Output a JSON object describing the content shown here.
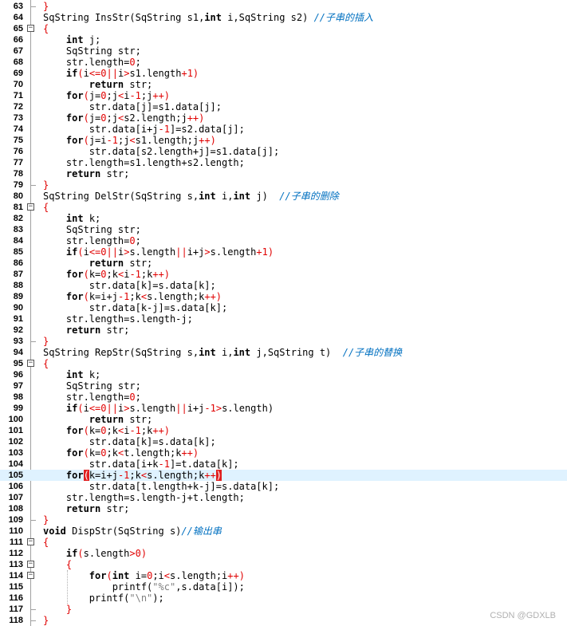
{
  "editor": {
    "lines": [
      {
        "n": "63",
        "fold": "end",
        "segs": [
          {
            "t": "}",
            "c": "tok-br"
          }
        ]
      },
      {
        "n": "64",
        "segs": [
          {
            "t": "SqString InsStr(SqString s1,"
          },
          {
            "t": "int",
            "c": "tok-kw"
          },
          {
            "t": " i,SqString s2) "
          },
          {
            "t": "//子串的插入",
            "c": "tok-com"
          }
        ]
      },
      {
        "n": "65",
        "fold": "box",
        "segs": [
          {
            "t": "{",
            "c": "tok-br"
          }
        ]
      },
      {
        "n": "66",
        "segs": [
          {
            "t": "    "
          },
          {
            "t": "int",
            "c": "tok-kw"
          },
          {
            "t": " j;"
          }
        ]
      },
      {
        "n": "67",
        "segs": [
          {
            "t": "    SqString str;"
          }
        ]
      },
      {
        "n": "68",
        "segs": [
          {
            "t": "    str.length="
          },
          {
            "t": "0",
            "c": "tok-num"
          },
          {
            "t": ";"
          }
        ]
      },
      {
        "n": "69",
        "segs": [
          {
            "t": "    "
          },
          {
            "t": "if",
            "c": "tok-kw"
          },
          {
            "t": "(",
            "c": "tok-op"
          },
          {
            "t": "i"
          },
          {
            "t": "<=",
            "c": "tok-op"
          },
          {
            "t": "0",
            "c": "tok-num"
          },
          {
            "t": "||",
            "c": "tok-op"
          },
          {
            "t": "i"
          },
          {
            "t": ">",
            "c": "tok-op"
          },
          {
            "t": "s1.length"
          },
          {
            "t": "+1)",
            "c": "tok-op"
          }
        ]
      },
      {
        "n": "70",
        "segs": [
          {
            "t": "        "
          },
          {
            "t": "return",
            "c": "tok-kw"
          },
          {
            "t": " str;"
          }
        ]
      },
      {
        "n": "71",
        "segs": [
          {
            "t": "    "
          },
          {
            "t": "for",
            "c": "tok-kw"
          },
          {
            "t": "(",
            "c": "tok-op"
          },
          {
            "t": "j="
          },
          {
            "t": "0",
            "c": "tok-num"
          },
          {
            "t": ";j"
          },
          {
            "t": "<",
            "c": "tok-op"
          },
          {
            "t": "i"
          },
          {
            "t": "-1",
            "c": "tok-op"
          },
          {
            "t": ";j"
          },
          {
            "t": "++)",
            "c": "tok-op"
          }
        ]
      },
      {
        "n": "72",
        "segs": [
          {
            "t": "        str.data[j]=s1.data[j];"
          }
        ]
      },
      {
        "n": "73",
        "segs": [
          {
            "t": "    "
          },
          {
            "t": "for",
            "c": "tok-kw"
          },
          {
            "t": "(",
            "c": "tok-op"
          },
          {
            "t": "j="
          },
          {
            "t": "0",
            "c": "tok-num"
          },
          {
            "t": ";j"
          },
          {
            "t": "<",
            "c": "tok-op"
          },
          {
            "t": "s2.length;j"
          },
          {
            "t": "++)",
            "c": "tok-op"
          }
        ]
      },
      {
        "n": "74",
        "segs": [
          {
            "t": "        str.data[i+j"
          },
          {
            "t": "-1",
            "c": "tok-op"
          },
          {
            "t": "]=s2.data[j];"
          }
        ]
      },
      {
        "n": "75",
        "segs": [
          {
            "t": "    "
          },
          {
            "t": "for",
            "c": "tok-kw"
          },
          {
            "t": "(",
            "c": "tok-op"
          },
          {
            "t": "j=i"
          },
          {
            "t": "-1",
            "c": "tok-op"
          },
          {
            "t": ";j"
          },
          {
            "t": "<",
            "c": "tok-op"
          },
          {
            "t": "s1.length;j"
          },
          {
            "t": "++)",
            "c": "tok-op"
          }
        ]
      },
      {
        "n": "76",
        "segs": [
          {
            "t": "        str.data[s2.length+j]=s1.data[j];"
          }
        ]
      },
      {
        "n": "77",
        "segs": [
          {
            "t": "    str.length=s1.length+s2.length;"
          }
        ]
      },
      {
        "n": "78",
        "segs": [
          {
            "t": "    "
          },
          {
            "t": "return",
            "c": "tok-kw"
          },
          {
            "t": " str;"
          }
        ]
      },
      {
        "n": "79",
        "fold": "end",
        "segs": [
          {
            "t": "}",
            "c": "tok-br"
          }
        ]
      },
      {
        "n": "80",
        "segs": [
          {
            "t": "SqString DelStr(SqString s,"
          },
          {
            "t": "int",
            "c": "tok-kw"
          },
          {
            "t": " i,"
          },
          {
            "t": "int",
            "c": "tok-kw"
          },
          {
            "t": " j)  "
          },
          {
            "t": "//子串的删除",
            "c": "tok-com"
          }
        ]
      },
      {
        "n": "81",
        "fold": "box",
        "segs": [
          {
            "t": "{",
            "c": "tok-br"
          }
        ]
      },
      {
        "n": "82",
        "segs": [
          {
            "t": "    "
          },
          {
            "t": "int",
            "c": "tok-kw"
          },
          {
            "t": " k;"
          }
        ]
      },
      {
        "n": "83",
        "segs": [
          {
            "t": "    SqString str;"
          }
        ]
      },
      {
        "n": "84",
        "segs": [
          {
            "t": "    str.length="
          },
          {
            "t": "0",
            "c": "tok-num"
          },
          {
            "t": ";"
          }
        ]
      },
      {
        "n": "85",
        "segs": [
          {
            "t": "    "
          },
          {
            "t": "if",
            "c": "tok-kw"
          },
          {
            "t": "(",
            "c": "tok-op"
          },
          {
            "t": "i"
          },
          {
            "t": "<=",
            "c": "tok-op"
          },
          {
            "t": "0",
            "c": "tok-num"
          },
          {
            "t": "||",
            "c": "tok-op"
          },
          {
            "t": "i"
          },
          {
            "t": ">",
            "c": "tok-op"
          },
          {
            "t": "s.length"
          },
          {
            "t": "||",
            "c": "tok-op"
          },
          {
            "t": "i+j"
          },
          {
            "t": ">",
            "c": "tok-op"
          },
          {
            "t": "s.length"
          },
          {
            "t": "+1)",
            "c": "tok-op"
          }
        ]
      },
      {
        "n": "86",
        "segs": [
          {
            "t": "        "
          },
          {
            "t": "return",
            "c": "tok-kw"
          },
          {
            "t": " str;"
          }
        ]
      },
      {
        "n": "87",
        "segs": [
          {
            "t": "    "
          },
          {
            "t": "for",
            "c": "tok-kw"
          },
          {
            "t": "(",
            "c": "tok-op"
          },
          {
            "t": "k="
          },
          {
            "t": "0",
            "c": "tok-num"
          },
          {
            "t": ";k"
          },
          {
            "t": "<",
            "c": "tok-op"
          },
          {
            "t": "i"
          },
          {
            "t": "-1",
            "c": "tok-op"
          },
          {
            "t": ";k"
          },
          {
            "t": "++)",
            "c": "tok-op"
          }
        ]
      },
      {
        "n": "88",
        "segs": [
          {
            "t": "        str.data[k]=s.data[k];"
          }
        ]
      },
      {
        "n": "89",
        "segs": [
          {
            "t": "    "
          },
          {
            "t": "for",
            "c": "tok-kw"
          },
          {
            "t": "(",
            "c": "tok-op"
          },
          {
            "t": "k=i+j"
          },
          {
            "t": "-1",
            "c": "tok-op"
          },
          {
            "t": ";k"
          },
          {
            "t": "<",
            "c": "tok-op"
          },
          {
            "t": "s.length;k"
          },
          {
            "t": "++)",
            "c": "tok-op"
          }
        ]
      },
      {
        "n": "90",
        "segs": [
          {
            "t": "        str.data[k-j]=s.data[k];"
          }
        ]
      },
      {
        "n": "91",
        "segs": [
          {
            "t": "    str.length=s.length-j;"
          }
        ]
      },
      {
        "n": "92",
        "segs": [
          {
            "t": "    "
          },
          {
            "t": "return",
            "c": "tok-kw"
          },
          {
            "t": " str;"
          }
        ]
      },
      {
        "n": "93",
        "fold": "end",
        "segs": [
          {
            "t": "}",
            "c": "tok-br"
          }
        ]
      },
      {
        "n": "94",
        "segs": [
          {
            "t": "SqString RepStr(SqString s,"
          },
          {
            "t": "int",
            "c": "tok-kw"
          },
          {
            "t": " i,"
          },
          {
            "t": "int",
            "c": "tok-kw"
          },
          {
            "t": " j,SqString t)  "
          },
          {
            "t": "//子串的替换",
            "c": "tok-com"
          }
        ]
      },
      {
        "n": "95",
        "fold": "box",
        "segs": [
          {
            "t": "{",
            "c": "tok-br"
          }
        ]
      },
      {
        "n": "96",
        "segs": [
          {
            "t": "    "
          },
          {
            "t": "int",
            "c": "tok-kw"
          },
          {
            "t": " k;"
          }
        ]
      },
      {
        "n": "97",
        "segs": [
          {
            "t": "    SqString str;"
          }
        ]
      },
      {
        "n": "98",
        "segs": [
          {
            "t": "    str.length="
          },
          {
            "t": "0",
            "c": "tok-num"
          },
          {
            "t": ";"
          }
        ]
      },
      {
        "n": "99",
        "segs": [
          {
            "t": "    "
          },
          {
            "t": "if",
            "c": "tok-kw"
          },
          {
            "t": "(",
            "c": "tok-op"
          },
          {
            "t": "i"
          },
          {
            "t": "<=",
            "c": "tok-op"
          },
          {
            "t": "0",
            "c": "tok-num"
          },
          {
            "t": "||",
            "c": "tok-op"
          },
          {
            "t": "i"
          },
          {
            "t": ">",
            "c": "tok-op"
          },
          {
            "t": "s.length"
          },
          {
            "t": "||",
            "c": "tok-op"
          },
          {
            "t": "i+j"
          },
          {
            "t": "-1",
            "c": "tok-op"
          },
          {
            "t": ">",
            "c": "tok-op"
          },
          {
            "t": "s.length)"
          }
        ]
      },
      {
        "n": "100",
        "segs": [
          {
            "t": "        "
          },
          {
            "t": "return",
            "c": "tok-kw"
          },
          {
            "t": " str;"
          }
        ]
      },
      {
        "n": "101",
        "segs": [
          {
            "t": "    "
          },
          {
            "t": "for",
            "c": "tok-kw"
          },
          {
            "t": "(",
            "c": "tok-op"
          },
          {
            "t": "k="
          },
          {
            "t": "0",
            "c": "tok-num"
          },
          {
            "t": ";k"
          },
          {
            "t": "<",
            "c": "tok-op"
          },
          {
            "t": "i"
          },
          {
            "t": "-1",
            "c": "tok-op"
          },
          {
            "t": ";k"
          },
          {
            "t": "++)",
            "c": "tok-op"
          }
        ]
      },
      {
        "n": "102",
        "segs": [
          {
            "t": "        str.data[k]=s.data[k];"
          }
        ]
      },
      {
        "n": "103",
        "segs": [
          {
            "t": "    "
          },
          {
            "t": "for",
            "c": "tok-kw"
          },
          {
            "t": "(",
            "c": "tok-op"
          },
          {
            "t": "k="
          },
          {
            "t": "0",
            "c": "tok-num"
          },
          {
            "t": ";k"
          },
          {
            "t": "<",
            "c": "tok-op"
          },
          {
            "t": "t.length;k"
          },
          {
            "t": "++)",
            "c": "tok-op"
          }
        ]
      },
      {
        "n": "104",
        "segs": [
          {
            "t": "        str.data[i+k"
          },
          {
            "t": "-1",
            "c": "tok-op"
          },
          {
            "t": "]=t.data[k];"
          }
        ]
      },
      {
        "n": "105",
        "hl": true,
        "segs": [
          {
            "t": "    "
          },
          {
            "t": "for",
            "c": "tok-kw"
          },
          {
            "t": "(",
            "c": "mbr"
          },
          {
            "t": "k=i+j"
          },
          {
            "t": "-1",
            "c": "tok-op"
          },
          {
            "t": ";k"
          },
          {
            "t": "<",
            "c": "tok-op"
          },
          {
            "t": "s.length;k"
          },
          {
            "t": "++",
            "c": "tok-op"
          },
          {
            "t": ")",
            "c": "mbr"
          }
        ]
      },
      {
        "n": "106",
        "segs": [
          {
            "t": "        str.data[t.length+k-j]=s.data[k];"
          }
        ]
      },
      {
        "n": "107",
        "segs": [
          {
            "t": "    str.length=s.length-j+t.length;"
          }
        ]
      },
      {
        "n": "108",
        "segs": [
          {
            "t": "    "
          },
          {
            "t": "return",
            "c": "tok-kw"
          },
          {
            "t": " str;"
          }
        ]
      },
      {
        "n": "109",
        "fold": "end",
        "segs": [
          {
            "t": "}",
            "c": "tok-br"
          }
        ]
      },
      {
        "n": "110",
        "segs": [
          {
            "t": "void",
            "c": "tok-kw"
          },
          {
            "t": " DispStr(SqString s)"
          },
          {
            "t": "//输出串",
            "c": "tok-com"
          }
        ]
      },
      {
        "n": "111",
        "fold": "box",
        "segs": [
          {
            "t": "{",
            "c": "tok-br"
          }
        ]
      },
      {
        "n": "112",
        "segs": [
          {
            "t": "    "
          },
          {
            "t": "if",
            "c": "tok-kw"
          },
          {
            "t": "(",
            "c": "tok-op"
          },
          {
            "t": "s.length"
          },
          {
            "t": ">",
            "c": "tok-op"
          },
          {
            "t": "0",
            "c": "tok-num"
          },
          {
            "t": ")",
            "c": "tok-op"
          }
        ]
      },
      {
        "n": "113",
        "fold": "box",
        "segs": [
          {
            "t": "    "
          },
          {
            "t": "{",
            "c": "tok-br"
          }
        ]
      },
      {
        "n": "114",
        "fold": "box",
        "segs": [
          {
            "t": "        "
          },
          {
            "t": "for",
            "c": "tok-kw"
          },
          {
            "t": "(",
            "c": "tok-op"
          },
          {
            "t": "int",
            "c": "tok-kw"
          },
          {
            "t": " i="
          },
          {
            "t": "0",
            "c": "tok-num"
          },
          {
            "t": ";i"
          },
          {
            "t": "<",
            "c": "tok-op"
          },
          {
            "t": "s.length;i"
          },
          {
            "t": "++)",
            "c": "tok-op"
          }
        ]
      },
      {
        "n": "115",
        "segs": [
          {
            "t": "            printf("
          },
          {
            "t": "\"%c\"",
            "c": "tok-str"
          },
          {
            "t": ",s.data[i]);"
          }
        ]
      },
      {
        "n": "116",
        "segs": [
          {
            "t": "        printf("
          },
          {
            "t": "\"\\n\"",
            "c": "tok-str"
          },
          {
            "t": ");"
          }
        ]
      },
      {
        "n": "117",
        "fold": "end",
        "segs": [
          {
            "t": "    "
          },
          {
            "t": "}",
            "c": "tok-br"
          }
        ]
      },
      {
        "n": "118",
        "fold": "end",
        "segs": [
          {
            "t": "}",
            "c": "tok-br"
          }
        ]
      }
    ]
  },
  "watermark": "CSDN @GDXLB"
}
